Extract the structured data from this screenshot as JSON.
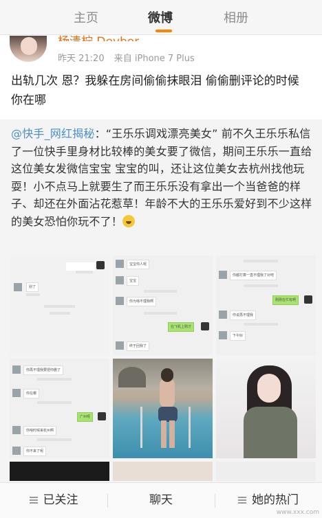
{
  "tabs": [
    "主页",
    "微博",
    "相册"
  ],
  "post": {
    "username": "杨清柠 Devbor",
    "time": "昨天 21:20",
    "source": "来自 iPhone 7 Plus",
    "text": "出轨几次 恩？我躲在房间偷偷抹眼泪 偷偷删评论的时候 你在哪"
  },
  "retweet": {
    "mention": "@快手_网红揭秘",
    "text": "：“王乐乐调戏漂亮美女” 前不久王乐乐私信了一位快手里身材比较棒的美女要了微信，期间王乐乐一直给这位美女发微信宝宝 宝宝的叫，还让这位美女去杭州找他玩耍！小不点马上就要生了而王乐乐没有拿出一个当爸爸的样子、却还在外面沾花惹草！年龄不大的王乐乐爱好到不少这样的美女恐怕你玩不了！"
  },
  "chat_bubbles": {
    "c1": [
      "别了"
    ],
    "c2": [
      "宝宝你人呢",
      "宝宝",
      "你为啥不理我啊",
      "在飞机上刚才",
      "终于回我了"
    ],
    "c3": [
      "你都打算一直不理我了对吧",
      "刚刚在忙有啊",
      "你说再不理我",
      "下午好"
    ],
    "c4": [
      "你再不理我要把你删了",
      "你在哪",
      "广州呀",
      "你啥时候来杭州啊",
      "你不来了呢"
    ]
  },
  "bottom": [
    "已关注",
    "聊天",
    "她的热门"
  ],
  "watermark": "www.xxx.com",
  "colors": {
    "accent": "#ff8200",
    "username": "#e8701a",
    "link": "#4f8ec9",
    "chat_green": "#a7e36e"
  }
}
